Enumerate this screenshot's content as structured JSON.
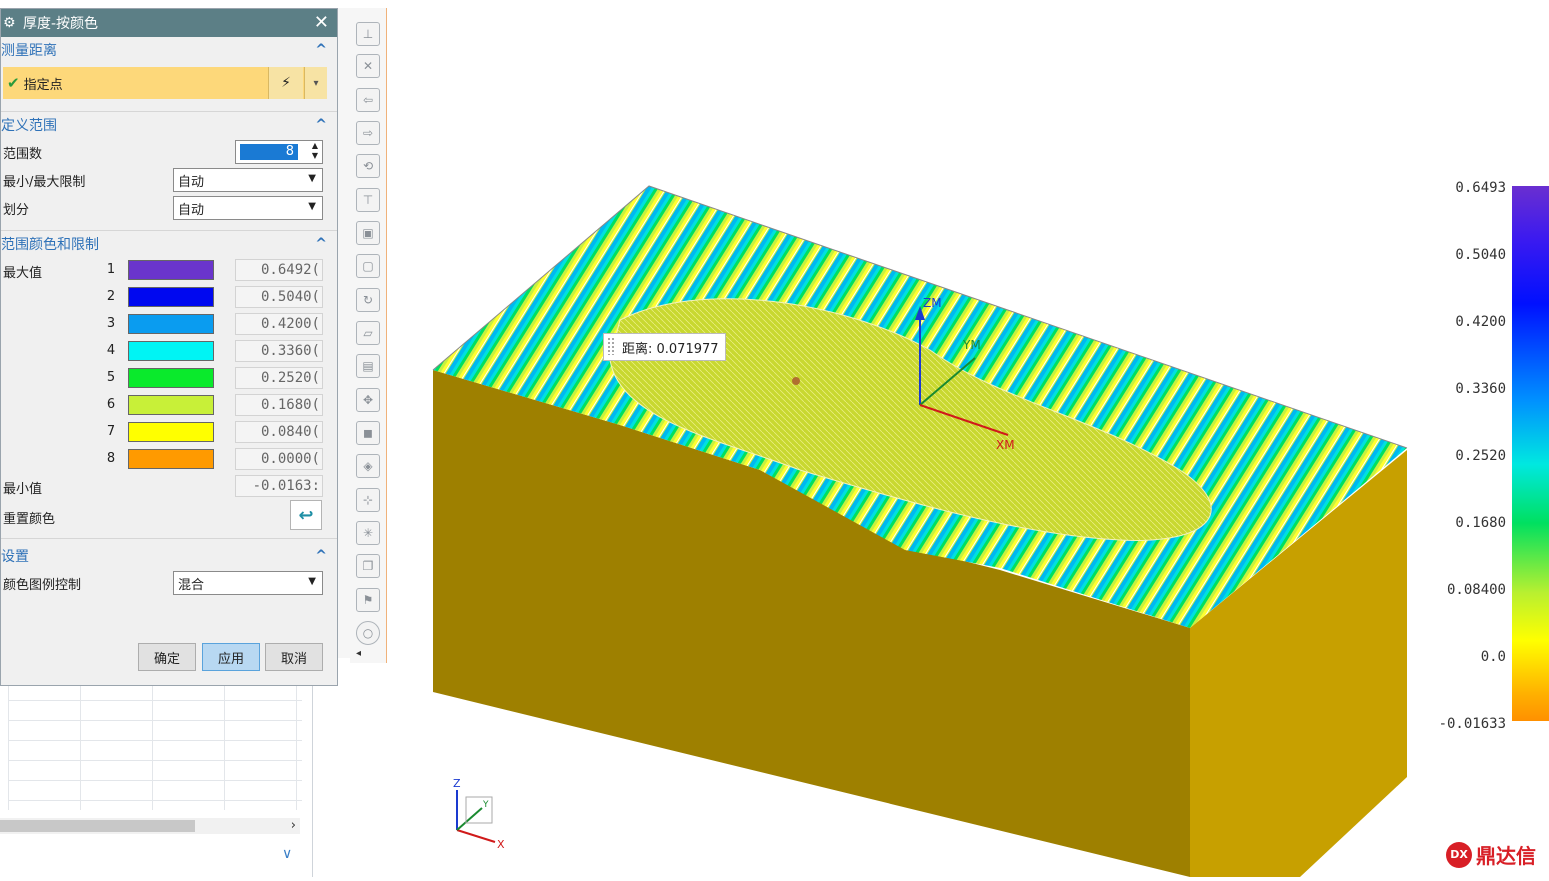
{
  "dialog": {
    "title": "厚度-按颜色",
    "sections": {
      "measure": {
        "title": "测量距离",
        "specify_point": "指定点"
      },
      "range": {
        "title": "定义范围",
        "range_count_label": "范围数",
        "range_count_value": "8",
        "minmax_label": "最小/最大限制",
        "minmax_value": "自动",
        "division_label": "划分",
        "division_value": "自动"
      },
      "colors": {
        "title": "范围颜色和限制",
        "max_label": "最大值",
        "min_label": "最小值",
        "min_value": "-0.0163:",
        "reset_label": "重置颜色",
        "entries": [
          {
            "index": "1",
            "color": "#6a35cc",
            "value": "0.6492("
          },
          {
            "index": "2",
            "color": "#0008f0",
            "value": "0.5040("
          },
          {
            "index": "3",
            "color": "#0a9cf0",
            "value": "0.4200("
          },
          {
            "index": "4",
            "color": "#00f4f4",
            "value": "0.3360("
          },
          {
            "index": "5",
            "color": "#0aea2c",
            "value": "0.2520("
          },
          {
            "index": "6",
            "color": "#c8f038",
            "value": "0.1680("
          },
          {
            "index": "7",
            "color": "#ffff00",
            "value": "0.0840("
          },
          {
            "index": "8",
            "color": "#ff9a00",
            "value": "0.0000("
          }
        ]
      },
      "settings": {
        "title": "设置",
        "legend_control_label": "颜色图例控制",
        "legend_control_value": "混合"
      }
    },
    "buttons": {
      "ok": "确定",
      "apply": "应用",
      "cancel": "取消"
    }
  },
  "viewport": {
    "distance_tip": "距离: 0.071977",
    "axes": {
      "zm": "ZM",
      "ym": "YM",
      "xm": "XM",
      "z": "Z",
      "x": "X",
      "y": "Y"
    },
    "legend": [
      "0.6493",
      "0.5040",
      "0.4200",
      "0.3360",
      "0.2520",
      "0.1680",
      "0.08400",
      "0.0",
      "-0.01633"
    ]
  },
  "watermark": "鼎达信",
  "colors": {
    "title_bar": "#5c7f86",
    "section_title": "#2f72b8",
    "selection": "#fdd87a",
    "block_side": "#9e8000",
    "block_front": "#c7a000"
  }
}
